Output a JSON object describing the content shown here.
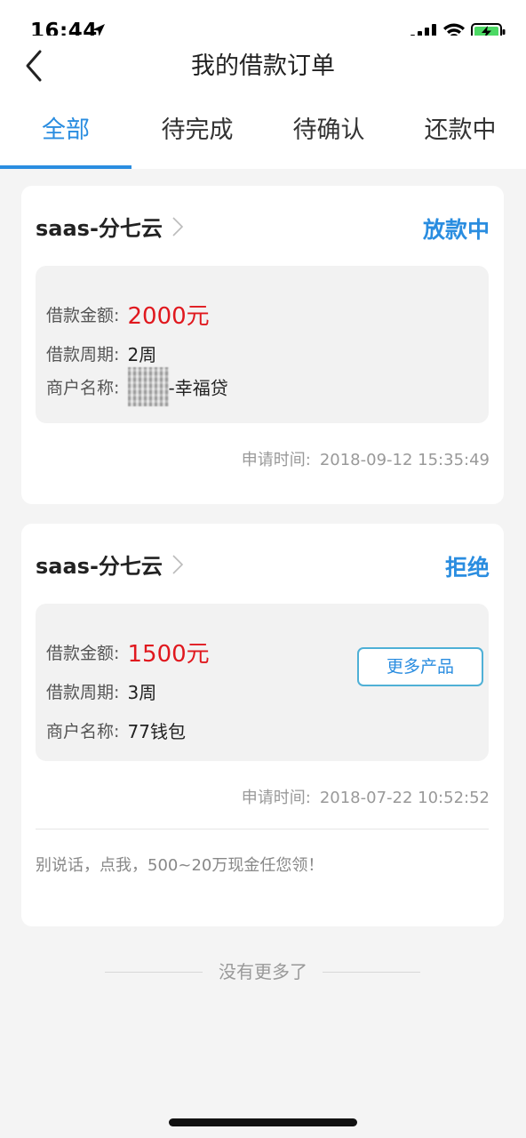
{
  "status_bar": {
    "time": "16:44",
    "icons": [
      "location-arrow-icon",
      "cellular-signal-icon",
      "wifi-icon",
      "battery-charging-icon"
    ],
    "battery_color": "#4cd964"
  },
  "nav": {
    "title": "我的借款订单",
    "back_icon": "chevron-left-icon"
  },
  "tabs": [
    {
      "label": "全部",
      "active": true
    },
    {
      "label": "待完成",
      "active": false
    },
    {
      "label": "待确认",
      "active": false
    },
    {
      "label": "还款中",
      "active": false
    }
  ],
  "colors": {
    "accent": "#2a8de0",
    "amount": "#e0181e",
    "background": "#f4f4f4"
  },
  "orders": [
    {
      "provider": "saas-分七云",
      "status": "放款中",
      "amount_label": "借款金额:",
      "amount": "2000元",
      "period_label": "借款周期:",
      "period": "2周",
      "merchant_label": "商户名称:",
      "merchant": "-幸福贷",
      "apply_time_label": "申请时间:",
      "apply_time": "2018-09-12 15:35:49"
    },
    {
      "provider": "saas-分七云",
      "status": "拒绝",
      "amount_label": "借款金额:",
      "amount": "1500元",
      "period_label": "借款周期:",
      "period": "3周",
      "merchant_label": "商户名称:",
      "merchant": "77钱包",
      "more_button": "更多产品",
      "apply_time_label": "申请时间:",
      "apply_time": "2018-07-22 10:52:52",
      "promo": "别说话，点我，500~20万现金任您领！"
    }
  ],
  "footer": {
    "no_more": "没有更多了"
  }
}
